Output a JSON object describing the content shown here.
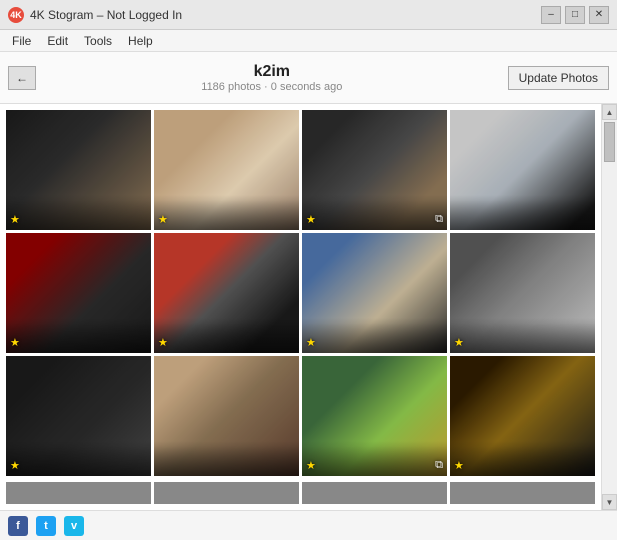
{
  "window": {
    "title": "4K Stogram – Not Logged In",
    "controls": {
      "minimize": "–",
      "maximize": "□",
      "close": "✕"
    }
  },
  "menu": {
    "items": [
      "File",
      "Edit",
      "Tools",
      "Help"
    ]
  },
  "header": {
    "back_label": "←",
    "profile_name": "k2im",
    "profile_meta": "1186 photos · 0 seconds ago",
    "update_button": "Update Photos"
  },
  "photos": [
    {
      "id": 1,
      "has_star": true,
      "has_album": false,
      "color_class": "photo-1"
    },
    {
      "id": 2,
      "has_star": true,
      "has_album": false,
      "color_class": "photo-2"
    },
    {
      "id": 3,
      "has_star": true,
      "has_album": true,
      "color_class": "photo-3"
    },
    {
      "id": 4,
      "has_star": false,
      "has_album": false,
      "color_class": "photo-4"
    },
    {
      "id": 5,
      "has_star": true,
      "has_album": false,
      "color_class": "photo-5"
    },
    {
      "id": 6,
      "has_star": true,
      "has_album": false,
      "color_class": "photo-6"
    },
    {
      "id": 7,
      "has_star": true,
      "has_album": false,
      "color_class": "photo-7"
    },
    {
      "id": 8,
      "has_star": true,
      "has_album": false,
      "color_class": "photo-8"
    },
    {
      "id": 9,
      "has_star": true,
      "has_album": false,
      "color_class": "photo-9"
    },
    {
      "id": 10,
      "has_star": false,
      "has_album": false,
      "color_class": "photo-10"
    },
    {
      "id": 11,
      "has_star": true,
      "has_album": true,
      "color_class": "photo-11"
    },
    {
      "id": 12,
      "has_star": true,
      "has_album": false,
      "color_class": "photo-12"
    }
  ],
  "partial_photos": [
    {
      "id": 13,
      "color_class": "photo-2"
    },
    {
      "id": 14,
      "color_class": "photo-7"
    },
    {
      "id": 15,
      "color_class": "photo-11"
    },
    {
      "id": 16,
      "color_class": "photo-4"
    }
  ],
  "social": {
    "facebook": "f",
    "twitter": "t",
    "vimeo": "v"
  }
}
